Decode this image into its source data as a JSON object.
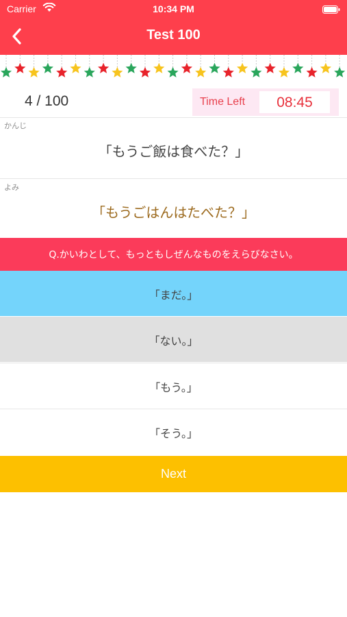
{
  "status_bar": {
    "carrier": "Carrier",
    "time": "10:34 PM"
  },
  "nav": {
    "title": "Test 100",
    "back_icon": "chevron-left-icon"
  },
  "decoration": {
    "icon": "star-garland",
    "colors": [
      "#2aa65c",
      "#e8232b",
      "#f7c41e"
    ]
  },
  "progress": {
    "text": "4 / 100"
  },
  "timer": {
    "label": "Time Left",
    "value": "08:45"
  },
  "kanji": {
    "label": "かんじ",
    "text": "「もうご飯は食べた？」"
  },
  "yomi": {
    "label": "よみ",
    "text": "「もうごはんはたべた？」"
  },
  "question": {
    "text": "Q.かいわとして、もっともしぜんなものをえらびなさい。"
  },
  "options": [
    {
      "text": "「まだ。」",
      "color": "#74d4fb",
      "state": "selected"
    },
    {
      "text": "「ない。」",
      "color": "#e0e0e0",
      "state": "highlighted"
    },
    {
      "text": "「もう。」",
      "color": "#ffffff",
      "state": "normal"
    },
    {
      "text": "「そう。」",
      "color": "#ffffff",
      "state": "normal"
    }
  ],
  "next_button": {
    "label": "Next"
  },
  "colors": {
    "header": "#fe3f4c",
    "question_bar": "#fb3b5a",
    "next_button": "#fdc000",
    "timer_bg": "#fde8f3",
    "timer_text": "#e8303b"
  }
}
